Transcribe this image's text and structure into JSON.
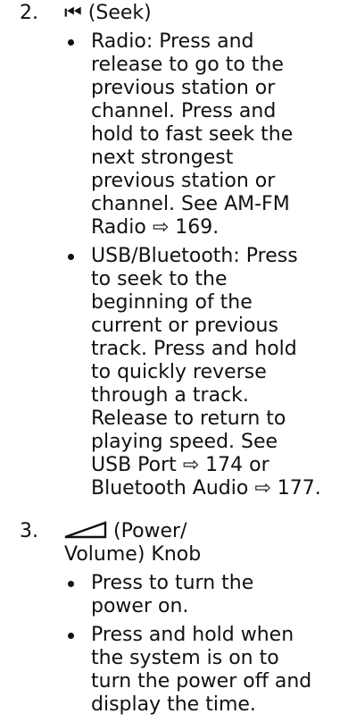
{
  "items": [
    {
      "number": "2.",
      "heading": "⏮ (Seek)",
      "icon": "seek-back-icon",
      "bullets": [
        {
          "lines": [
            "Radio: Press and",
            "release to go to the",
            "previous station or",
            "channel. Press and",
            "hold to fast seek the",
            "next strongest",
            "previous station or",
            "channel. See AM-FM",
            "Radio ⇨ 169."
          ]
        },
        {
          "lines": [
            "USB/Bluetooth: Press",
            "to seek to the",
            "beginning of the",
            "current or previous",
            "track. Press and hold",
            "to quickly reverse",
            "through a track.",
            "Release to return to",
            "playing speed. See",
            "USB Port ⇨ 174 or",
            "Bluetooth Audio ⇨ 177."
          ]
        }
      ]
    },
    {
      "number": "3.",
      "heading_line1": "(Power/",
      "heading_line2": "Volume) Knob",
      "icon": "volume-ramp-icon",
      "bullets": [
        {
          "lines": [
            "Press to turn the",
            "power on."
          ]
        },
        {
          "lines": [
            "Press and hold when",
            "the system is on to",
            "turn the power off and",
            "display the time."
          ]
        }
      ]
    }
  ]
}
